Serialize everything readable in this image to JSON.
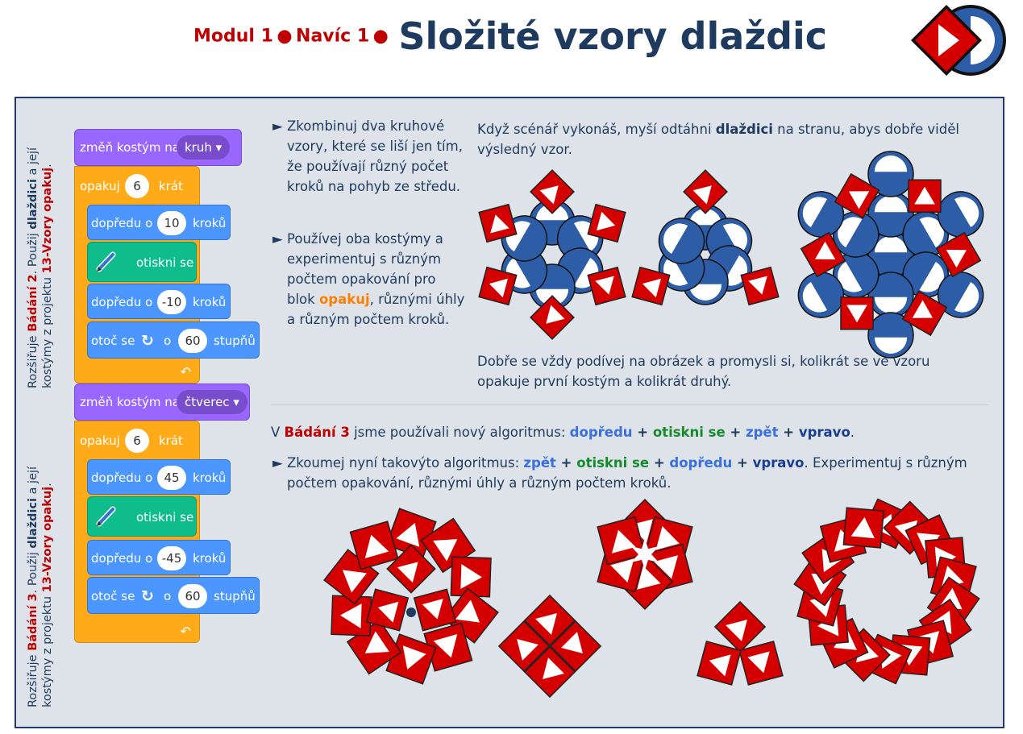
{
  "header": {
    "modul": "Modul 1",
    "dot1": "●",
    "navic": "Navíc 1",
    "dot2": "●",
    "title": "Složité vzory dlaždic"
  },
  "colors": {
    "red": "#c00000",
    "navy": "#1f3a5f",
    "panel": "#dde3e8",
    "tile_red": "#d40000",
    "circle_blue": "#2e5da8"
  },
  "side_top": {
    "l1_a": "Rozšiřuje ",
    "l1_b": "Bádání 2",
    "l1_c": ". Použij ",
    "l1_d": "dlaždici",
    "l1_e": " a její",
    "l2_a": "kostýmy z projektu ",
    "l2_b": "13-Vzory opakuj",
    "l2_c": "."
  },
  "side_bottom": {
    "l1_a": "Rozšiřuje ",
    "l1_b": "Bádání 3",
    "l1_c": ". Použij ",
    "l1_d": "dlaždici",
    "l1_e": " a její",
    "l2_a": "kostýmy z projektu ",
    "l2_b": "13-Vzory opakuj",
    "l2_c": "."
  },
  "script1": {
    "switch_label": "změň kostým na",
    "switch_value": "kruh ▾",
    "repeat_label": "opakuj",
    "repeat_count": "6",
    "repeat_unit": "krát",
    "move1_label": "dopředu o",
    "move1_value": "10",
    "move1_unit": "kroků",
    "stamp_label": "otiskni se",
    "move2_label": "dopředu o",
    "move2_value": "-10",
    "move2_unit": "kroků",
    "turn_label": "otoč se",
    "turn_icon": "↻",
    "turn_o": "o",
    "turn_value": "60",
    "turn_unit": "stupňů",
    "loop_icon": "↶"
  },
  "script2": {
    "switch_label": "změň kostým na",
    "switch_value": "čtverec ▾",
    "repeat_label": "opakuj",
    "repeat_count": "6",
    "repeat_unit": "krát",
    "move1_label": "dopředu o",
    "move1_value": "45",
    "move1_unit": "kroků",
    "stamp_label": "otiskni se",
    "move2_label": "dopředu o",
    "move2_value": "-45",
    "move2_unit": "kroků",
    "turn_label": "otoč se",
    "turn_icon": "↻",
    "turn_o": "o",
    "turn_value": "60",
    "turn_unit": "stupňů",
    "loop_icon": "↶"
  },
  "bullets1": {
    "b1": "Zkombinuj dva kruhové vzory, které se liší jen tím, že používají různý počet kroků na pohyb ze středu.",
    "b2_a": "Používej oba kostýmy a experimentuj s různým počtem opakování pro blok ",
    "b2_b": "opakuj",
    "b2_c": ", různými úhly a různým počtem kroků."
  },
  "intro": {
    "a": "Když scénář vykonáš, myší odtáhni ",
    "b": "dlaždici",
    "c": " na stranu, abys dobře viděl výsledný vzor."
  },
  "note": "Dobře se vždy podívej na obrázek a promysli si, kolikrát se ve vzoru opakuje první kostým a kolikrát druhý.",
  "algo": {
    "a": "V ",
    "b": "Bádání 3",
    "c": " jsme používali nový algoritmus: ",
    "d": "dopředu",
    "p1": " + ",
    "e": "otiskni se",
    "p2": " + ",
    "f": "zpět",
    "p3": " + ",
    "g": "vpravo",
    "h": "."
  },
  "algo2": {
    "a": "Zkoumej nyní takovýto algoritmus: ",
    "b": "zpět",
    "p1": " + ",
    "c": "otiskni se",
    "p2": " + ",
    "d": "dopředu",
    "p3": " + ",
    "e": "vpravo",
    "f": ". Experimentuj s různým počtem opakování, různými úhly a různým počtem kroků."
  },
  "bullet_glyph": "►"
}
